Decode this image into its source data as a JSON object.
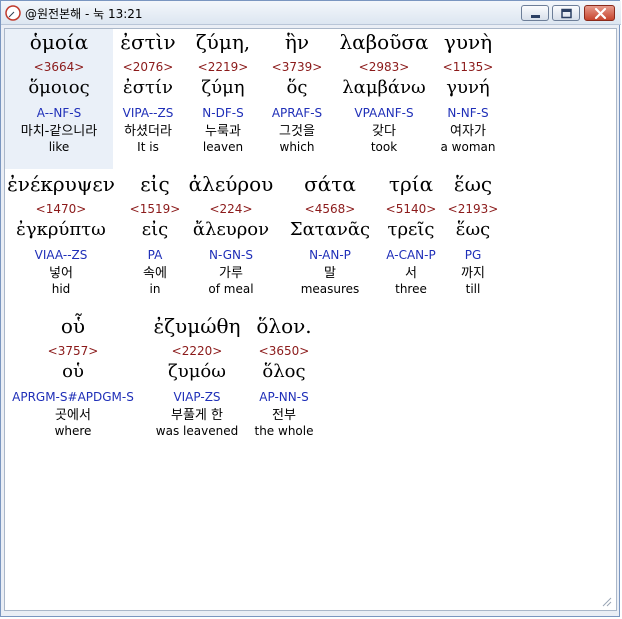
{
  "window": {
    "title": "@원전본해 - 눅 13:21"
  },
  "rows": [
    {
      "words": [
        {
          "greek": "ὁμοία",
          "strong": "<3664>",
          "lemma": "ὅμοιος",
          "morph": "A--NF-S",
          "korean": "마치-같으니라",
          "english": "like"
        },
        {
          "greek": "ἐστὶν",
          "strong": "<2076>",
          "lemma": "ἐστίν",
          "morph": "VIPA--ZS",
          "korean": "하셨더라",
          "english": "It is"
        },
        {
          "greek": "ζύμη,",
          "strong": "<2219>",
          "lemma": "ζύμη",
          "morph": "N-DF-S",
          "korean": "누룩과",
          "english": "leaven"
        },
        {
          "greek": "ἣν",
          "strong": "<3739>",
          "lemma": "ὅς",
          "morph": "APRAF-S",
          "korean": "그것을",
          "english": "which"
        },
        {
          "greek": "λαβοῦσα",
          "strong": "<2983>",
          "lemma": "λαμβάνω",
          "morph": "VPAANF-S",
          "korean": "갖다",
          "english": "took"
        },
        {
          "greek": "γυνὴ",
          "strong": "<1135>",
          "lemma": "γυνή",
          "morph": "N-NF-S",
          "korean": "여자가",
          "english": "a woman"
        }
      ]
    },
    {
      "words": [
        {
          "greek": "ἐνέκρυψεν",
          "strong": "<1470>",
          "lemma": "ἐγκρύπτω",
          "morph": "VIAA--ZS",
          "korean": "넣어",
          "english": "hid"
        },
        {
          "greek": "εἰς",
          "strong": "<1519>",
          "lemma": "εἰς",
          "morph": "PA",
          "korean": "속에",
          "english": "in"
        },
        {
          "greek": "ἀλεύρου",
          "strong": "<224>",
          "lemma": "ἄλευρον",
          "morph": "N-GN-S",
          "korean": "가루",
          "english": "of meal"
        },
        {
          "greek": "σάτα",
          "strong": "<4568>",
          "lemma": "Σατανᾶς",
          "morph": "N-AN-P",
          "korean": "말",
          "english": "measures"
        },
        {
          "greek": "τρία",
          "strong": "<5140>",
          "lemma": "τρεῖς",
          "morph": "A-CAN-P",
          "korean": "서",
          "english": "three"
        },
        {
          "greek": "ἕως",
          "strong": "<2193>",
          "lemma": "ἕως",
          "morph": "PG",
          "korean": "까지",
          "english": "till"
        }
      ]
    },
    {
      "words": [
        {
          "greek": "οὗ",
          "strong": "<3757>",
          "lemma": "οὑ",
          "morph": "APRGM-S#APDGM-S",
          "korean": "곳에서",
          "english": "where"
        },
        {
          "greek": "ἐζυμώθη",
          "strong": "<2220>",
          "lemma": "ζυμόω",
          "morph": "VIAP-ZS",
          "korean": "부풀게 한",
          "english": "was leavened"
        },
        {
          "greek": "ὅλον.",
          "strong": "<3650>",
          "lemma": "ὅλος",
          "morph": "AP-NN-S",
          "korean": "전부",
          "english": "the whole"
        }
      ]
    }
  ]
}
